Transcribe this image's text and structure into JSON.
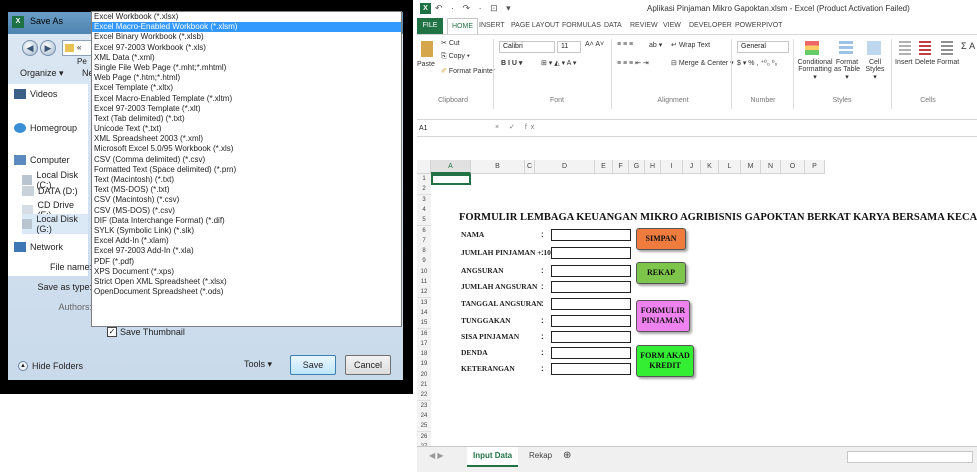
{
  "save_as": {
    "title": "Save As",
    "address_text": "« Pe",
    "organize_label": "Organize ▾",
    "organize_trailing": "Ne",
    "nav_items": [
      {
        "label": "Videos",
        "icon": "video-folder-icon"
      },
      {
        "label": "Homegroup",
        "icon": "homegroup-icon"
      },
      {
        "label": "Computer",
        "icon": "computer-icon"
      },
      {
        "label": "Local Disk (C:)",
        "icon": "drive-icon"
      },
      {
        "label": "DATA (D:)",
        "icon": "drive-icon"
      },
      {
        "label": "CD Drive (F:)",
        "icon": "cd-drive-icon"
      },
      {
        "label": "Local Disk (G:)",
        "icon": "drive-icon"
      },
      {
        "label": "Network",
        "icon": "network-icon"
      }
    ],
    "file_name_label": "File name:",
    "save_as_type_label": "Save as type:",
    "authors_label": "Authors:",
    "save_thumbnail_label": "Save Thumbnail",
    "save_thumbnail_checked": true,
    "hide_folders_label": "Hide Folders",
    "tools_label": "Tools",
    "save_button": "Save",
    "cancel_button": "Cancel",
    "file_types": [
      "Excel Workbook (*.xlsx)",
      "Excel Macro-Enabled Workbook (*.xlsm)",
      "Excel Binary Workbook (*.xlsb)",
      "Excel 97-2003 Workbook (*.xls)",
      "XML Data (*.xml)",
      "Single File Web Page (*.mht;*.mhtml)",
      "Web Page (*.htm;*.html)",
      "Excel Template (*.xltx)",
      "Excel Macro-Enabled Template (*.xltm)",
      "Excel 97-2003 Template (*.xlt)",
      "Text (Tab delimited) (*.txt)",
      "Unicode Text (*.txt)",
      "XML Spreadsheet 2003 (*.xml)",
      "Microsoft Excel 5.0/95 Workbook (*.xls)",
      "CSV (Comma delimited) (*.csv)",
      "Formatted Text (Space delimited) (*.prn)",
      "Text (Macintosh) (*.txt)",
      "Text (MS-DOS) (*.txt)",
      "CSV (Macintosh) (*.csv)",
      "CSV (MS-DOS) (*.csv)",
      "DIF (Data Interchange Format) (*.dif)",
      "SYLK (Symbolic Link) (*.slk)",
      "Excel Add-In (*.xlam)",
      "Excel 97-2003 Add-In (*.xla)",
      "PDF (*.pdf)",
      "XPS Document (*.xps)",
      "Strict Open XML Spreadsheet (*.xlsx)",
      "OpenDocument Spreadsheet (*.ods)"
    ],
    "selected_index": 1
  },
  "excel": {
    "window_title": "Aplikasi Pinjaman Mikro Gapoktan.xlsm - Excel (Product Activation Failed)",
    "quick_access": "↶ · ↷ · ⊡ ▾",
    "tabs": [
      "FILE",
      "HOME",
      "INSERT",
      "PAGE LAYOUT",
      "FORMULAS",
      "DATA",
      "REVIEW",
      "VIEW",
      "DEVELOPER",
      "POWERPIVOT"
    ],
    "active_tab": "HOME",
    "ribbon": {
      "paste": "Paste",
      "cut": "Cut",
      "copy": "Copy ▾",
      "format_painter": "Format Painter",
      "font_name": "Calibri",
      "font_size": "11",
      "font_grow": "A˄ A˅",
      "bold_italic_underline": "B  I  U ▾",
      "font_extras": "⊞ ▾  ◭ ▾  A ▾",
      "align_top": "≡ ≡ ≡",
      "orientation": "ab ▾",
      "align_bottom": "≡ ≡ ≡  ⇤ ⇥",
      "wrap_text": "Wrap Text",
      "merge_center": "Merge & Center ▾",
      "number_format": "General",
      "number_symbols": "$ ▾ %  ,  ⁺⁰₀ ⁰₀",
      "conditional_formatting": "Conditional Formatting ▾",
      "format_as_table": "Format as Table ▾",
      "cell_styles": "Cell Styles ▾",
      "insert": "Insert",
      "delete": "Delete",
      "format": "Format",
      "sigma": "Σ A",
      "groups": [
        "Clipboard",
        "Font",
        "Alignment",
        "Number",
        "Styles",
        "Cells"
      ]
    },
    "name_box": "A1",
    "formula_icons": "× ✓ fx",
    "columns": [
      "A",
      "B",
      "C",
      "D",
      "E",
      "F",
      "G",
      "H",
      "I",
      "J",
      "K",
      "L",
      "M",
      "N",
      "O",
      "P"
    ],
    "rows": [
      "1",
      "2",
      "3",
      "4",
      "5",
      "6",
      "7",
      "8",
      "9",
      "10",
      "11",
      "12",
      "13",
      "14",
      "15",
      "16",
      "17",
      "18",
      "19",
      "20",
      "21",
      "22",
      "23",
      "24",
      "25",
      "26",
      "27"
    ],
    "form_title": "FORMULIR LEMBAGA KEUANGAN MIKRO AGRIBISNIS GAPOKTAN BERKAT KARYA BERSAMA KECAMATAN LANDASAN ULIN UTARA",
    "form_fields": [
      {
        "label": "NAMA"
      },
      {
        "label": "JUMLAH PINJAMAN + 10%"
      },
      {
        "label": "ANGSURAN"
      },
      {
        "label": "JUMLAH ANGSURAN"
      },
      {
        "label": "TANGGAL ANGSURAN"
      },
      {
        "label": "TUNGGAKAN"
      },
      {
        "label": "SISA PINJAMAN"
      },
      {
        "label": "DENDA"
      },
      {
        "label": "KETERANGAN"
      }
    ],
    "colon": ":",
    "buttons": {
      "simpan": {
        "label": "SIMPAN",
        "color": "#f07b3f"
      },
      "rekap": {
        "label": "REKAP",
        "color": "#7dc64b"
      },
      "formulir": {
        "label": "FORMULIR PINJAMAN",
        "color": "#ee82ee"
      },
      "akad": {
        "label": "FORM AKAD KREDIT",
        "color": "#33ee33"
      }
    },
    "sheet_tabs": [
      "Input Data",
      "Rekap"
    ],
    "active_sheet": "Input Data",
    "add_sheet": "⊕"
  }
}
